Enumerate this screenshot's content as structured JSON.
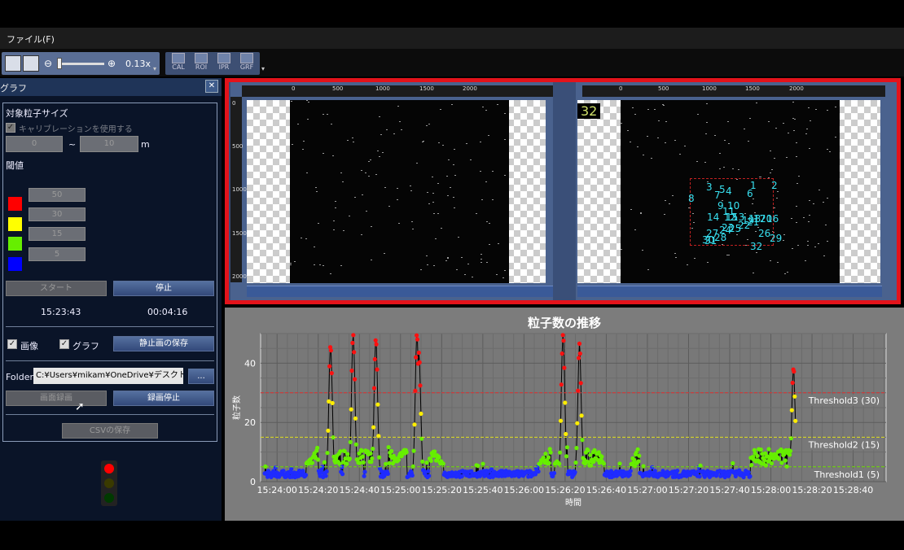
{
  "menu": {
    "file": "ファイル(F)"
  },
  "toolbar": {
    "zoom_level": "0.13x",
    "zoom_slider_fraction": 0.05,
    "tools": [
      "CAL",
      "ROI",
      "IPR",
      "GRF"
    ]
  },
  "panel": {
    "title": "グラフ",
    "close": "✕",
    "particle_size_heading": "対象粒子サイズ",
    "calibration_label": "キャリブレーションを使用する",
    "size_min": "0",
    "size_max": "10",
    "size_sep": "~",
    "size_unit": "m",
    "threshold_heading": "閾値",
    "thresholds": [
      {
        "color": "#ff0000",
        "value": "50"
      },
      {
        "color": "#ffff00",
        "value": "30"
      },
      {
        "color": "#66ee00",
        "value": "15"
      },
      {
        "color": "#0000ff",
        "value": "5"
      }
    ],
    "start_button": "スタート",
    "stop_button": "停止",
    "start_time": "15:23:43",
    "elapsed_time": "00:04:16",
    "image_check_label": "画像",
    "graph_check_label": "グラフ",
    "save_still_button": "静止画の保存",
    "folder_label": "Folder:",
    "folder_path": "C:¥Users¥mikam¥OneDrive¥デスクトップ",
    "browse_button": "...",
    "screen_record_button": "画面録画",
    "stop_record_button": "録画停止",
    "save_csv_button": "CSVの保存"
  },
  "views": {
    "ruler_h_labels": [
      "0",
      "500",
      "1000",
      "1500",
      "2000"
    ],
    "ruler_v_labels": [
      "0",
      "500",
      "1000",
      "1500",
      "2000"
    ],
    "particle_count": "32",
    "particle_labels": [
      "1",
      "2",
      "3",
      "4",
      "5",
      "6",
      "7",
      "8",
      "9",
      "10",
      "11",
      "12",
      "13",
      "14",
      "15",
      "16",
      "17",
      "18",
      "19",
      "20",
      "21",
      "22",
      "23",
      "24",
      "25",
      "26",
      "27",
      "28",
      "29",
      "30",
      "31",
      "32"
    ]
  },
  "chart_data": {
    "type": "scatter",
    "title": "粒子数の推移",
    "xlabel": "時間",
    "ylabel": "粒子数",
    "ylim": [
      0,
      50
    ],
    "yticks": [
      0,
      20,
      40
    ],
    "xticks": [
      "15:24:00",
      "15:24:20",
      "15:24:40",
      "15:25:00",
      "15:25:20",
      "15:25:40",
      "15:26:00",
      "15:26:20",
      "15:26:40",
      "15:27:00",
      "15:27:20",
      "15:27:40",
      "15:28:00",
      "15:28:20",
      "15:28:40"
    ],
    "xlim_seconds_from_first_tick": [
      -8,
      296
    ],
    "grid": true,
    "thresholds": [
      {
        "label": "Threshold3 (30)",
        "value": 30,
        "color": "#e03030"
      },
      {
        "label": "Threshold2 (15)",
        "value": 15,
        "color": "#e0e020"
      },
      {
        "label": "Threshold1 (5)",
        "value": 5,
        "color": "#70e000"
      }
    ],
    "bursts": [
      {
        "t": 26,
        "peak": 45
      },
      {
        "t": 37,
        "peak": 49
      },
      {
        "t": 48,
        "peak": 47
      },
      {
        "t": 68,
        "peak": 49
      },
      {
        "t": 69,
        "peak": 42
      },
      {
        "t": 139,
        "peak": 49
      },
      {
        "t": 147,
        "peak": 45
      },
      {
        "t": 251,
        "peak": 37
      }
    ],
    "point_colors": {
      "low": "#1f2bff",
      "mid": "#66ee00",
      "high": "#ffee00",
      "top": "#ff1010"
    },
    "point_ranges": [
      {
        "from": 0,
        "to": 5,
        "color": "low"
      },
      {
        "from": 5,
        "to": 15,
        "color": "mid"
      },
      {
        "from": 15,
        "to": 30,
        "color": "high"
      },
      {
        "from": 30,
        "to": 50,
        "color": "top"
      }
    ]
  },
  "traffic_light": {
    "red": "#ff0000",
    "yellow": "#3a3a00",
    "green": "#003a00"
  }
}
